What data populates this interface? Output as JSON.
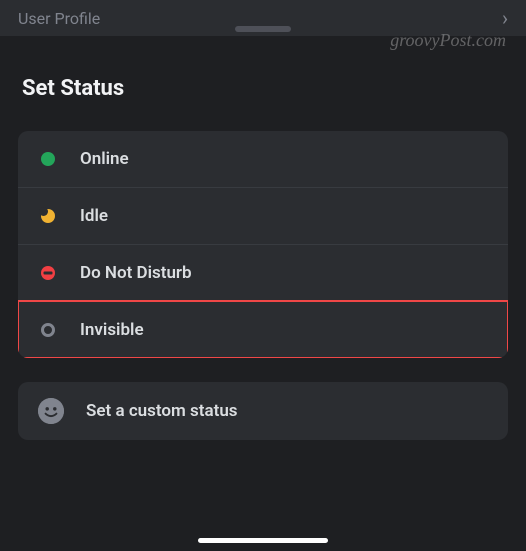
{
  "top": {
    "title": "User Profile"
  },
  "sheet": {
    "title": "Set Status"
  },
  "statuses": [
    {
      "label": "Online"
    },
    {
      "label": "Idle"
    },
    {
      "label": "Do Not Disturb"
    },
    {
      "label": "Invisible"
    }
  ],
  "custom": {
    "label": "Set a custom status"
  },
  "watermark": "groovyPost.com"
}
